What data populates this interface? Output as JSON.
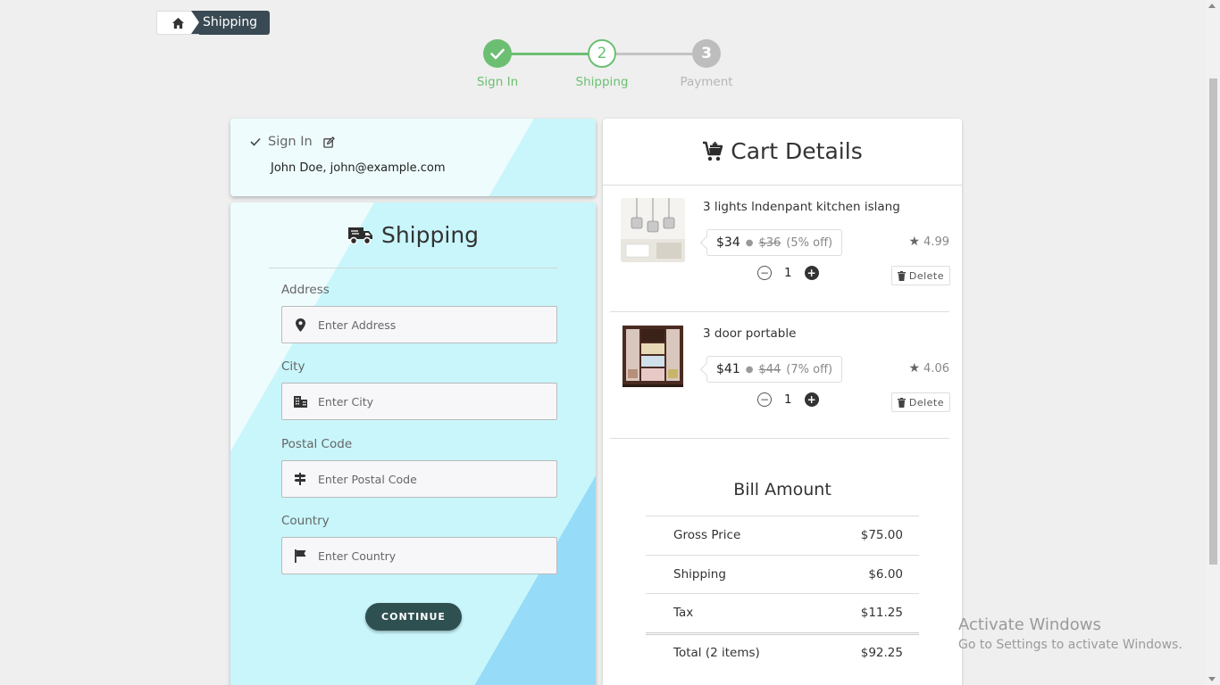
{
  "breadcrumb": {
    "current": "Shipping"
  },
  "stepper": {
    "steps": [
      {
        "label": "Sign In",
        "status": "complete"
      },
      {
        "label": "Shipping",
        "number": "2",
        "status": "active"
      },
      {
        "label": "Payment",
        "number": "3",
        "status": "pending"
      }
    ]
  },
  "signin": {
    "title": "Sign In",
    "user": "John Doe, john@example.com"
  },
  "shipping": {
    "title": "Shipping",
    "fields": [
      {
        "label": "Address",
        "placeholder": "Enter Address",
        "icon": "location-pin-icon"
      },
      {
        "label": "City",
        "placeholder": "Enter City",
        "icon": "city-icon"
      },
      {
        "label": "Postal Code",
        "placeholder": "Enter Postal Code",
        "icon": "signpost-icon"
      },
      {
        "label": "Country",
        "placeholder": "Enter Country",
        "icon": "flag-icon"
      }
    ],
    "continue_label": "CONTINUE"
  },
  "cart": {
    "title": "Cart Details",
    "items": [
      {
        "name": "3 lights lndenpant kitchen islang",
        "price": "$34",
        "original_price": "$36",
        "discount": "(5% off)",
        "rating": "4.99",
        "quantity": "1",
        "delete_label": "Delete"
      },
      {
        "name": "3 door portable",
        "price": "$41",
        "original_price": "$44",
        "discount": "(7% off)",
        "rating": "4.06",
        "quantity": "1",
        "delete_label": "Delete"
      }
    ],
    "bill": {
      "title": "Bill Amount",
      "rows": [
        {
          "label": "Gross Price",
          "value": "$75.00"
        },
        {
          "label": "Shipping",
          "value": "$6.00"
        },
        {
          "label": "Tax",
          "value": "$11.25"
        },
        {
          "label": "Total (2 items)",
          "value": "$92.25"
        }
      ]
    }
  },
  "watermark": {
    "line1": "Activate Windows",
    "line2": "Go to Settings to activate Windows."
  },
  "colors": {
    "accent_green": "#6cbf72",
    "button_dark": "#2f5050",
    "breadcrumb_dark": "#3a4a54"
  }
}
